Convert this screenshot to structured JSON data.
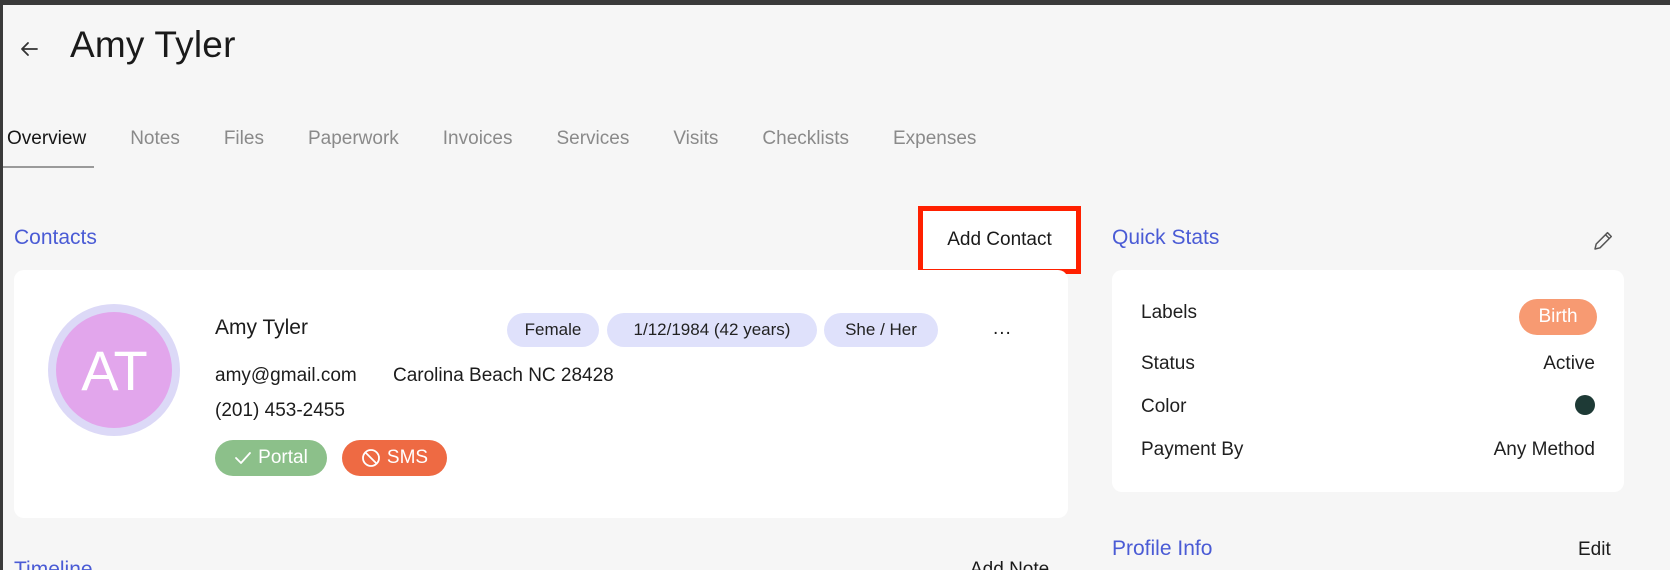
{
  "page": {
    "title": "Amy Tyler"
  },
  "tabs": [
    "Overview",
    "Notes",
    "Files",
    "Paperwork",
    "Invoices",
    "Services",
    "Visits",
    "Checklists",
    "Expenses"
  ],
  "contacts": {
    "section_title": "Contacts",
    "add_button": "Add Contact",
    "contact": {
      "initials": "AT",
      "name": "Amy Tyler",
      "tags": [
        "Female",
        "1/12/1984 (42 years)",
        "She / Her"
      ],
      "more": "...",
      "email": "amy@gmail.com",
      "location": "Carolina Beach NC 28428",
      "phone": "(201) 453-2455",
      "portal": "Portal",
      "sms": "SMS"
    }
  },
  "quick_stats": {
    "section_title": "Quick Stats",
    "labels_label": "Labels",
    "labels_value": "Birth",
    "status_label": "Status",
    "status_value": "Active",
    "color_label": "Color",
    "color_value": "#1e3a36",
    "payment_label": "Payment By",
    "payment_value": "Any Method"
  },
  "profile_info": {
    "section_title": "Profile Info",
    "edit": "Edit"
  },
  "timeline": {
    "section_title": "Timeline",
    "add_link": "Add Note"
  },
  "colors": {
    "accent": "#4a5bd5",
    "highlight_border": "#ff2000",
    "portal_badge": "#8cc08a",
    "sms_badge": "#ee6a43",
    "avatar": "#e2a6ec",
    "birth_label": "#f79a72"
  },
  "icons": [
    "back-arrow-icon",
    "pencil-icon",
    "check-icon",
    "blocked-icon"
  ]
}
